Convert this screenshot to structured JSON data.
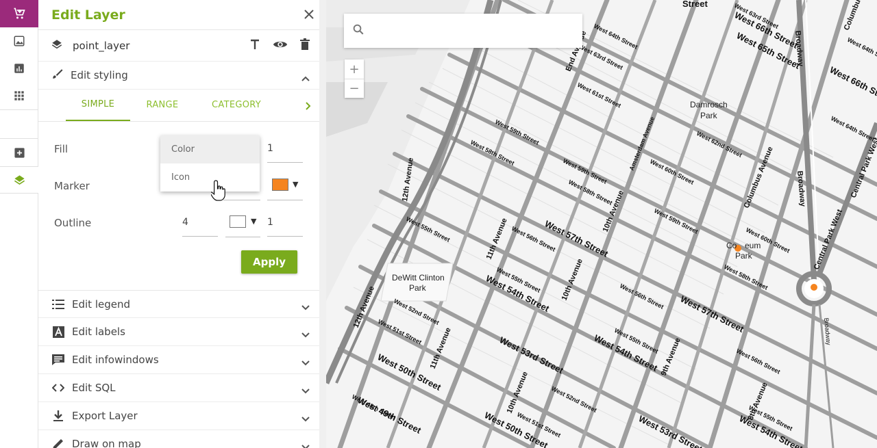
{
  "panel": {
    "title": "Edit Layer",
    "layer_name": "point_layer",
    "sections_open": {
      "edit_styling": "Edit styling"
    },
    "tabs": [
      "SIMPLE",
      "RANGE",
      "CATEGORY"
    ],
    "fields": {
      "fill_label": "Fill",
      "fill_opacity": "1",
      "marker_label": "Marker",
      "marker_color": "#f5841f",
      "outline_label": "Outline",
      "outline_width": "4",
      "outline_color": "#ffffff",
      "outline_opacity": "1"
    },
    "dropdown_options": [
      "Color",
      "Icon"
    ],
    "apply_label": "Apply",
    "sections": [
      {
        "label": "Edit legend",
        "icon": "list-icon"
      },
      {
        "label": "Edit labels",
        "icon": "label-icon"
      },
      {
        "label": "Edit infowindows",
        "icon": "infowindow-icon"
      },
      {
        "label": "Edit SQL",
        "icon": "code-icon"
      },
      {
        "label": "Export Layer",
        "icon": "download-icon"
      },
      {
        "label": "Draw on map",
        "icon": "pencil-icon"
      }
    ]
  },
  "colors": {
    "accent": "#7aab1d",
    "rail_active": "#9b2a7b",
    "marker": "#f5841f"
  },
  "map": {
    "search_placeholder": "",
    "zoom_in": "+",
    "zoom_out": "−",
    "labels": {
      "w64": "West 64th Street",
      "w63": "West 63rd Street",
      "w61": "West 61st Street",
      "w59a": "West 59th Street",
      "w58a": "West 58th Street",
      "w59b": "West 59th Street",
      "w58b": "West 58th Street",
      "w62": "West 62nd Street",
      "w60a": "West 60th Street",
      "w59c": "West 59th Street",
      "w60b": "West 60th Street",
      "w58c": "West 58th Street",
      "w55a": "West 55th Street",
      "w56a": "West 56th Street",
      "w57a": "West 57th Street",
      "w55b": "West 55th Street",
      "w54a": "West 54th Street",
      "w56b": "West 56th Street",
      "w57b": "West 57th Street",
      "w52a": "West 52nd Street",
      "w51a": "West 51st Street",
      "w50a": "West 50th Street",
      "w53a": "West 53rd Street",
      "w55c": "West 55th Street",
      "w54b": "West 54th Street",
      "w56c": "West 56th Street",
      "w49": "West 49th Street",
      "w48": "West 48th Street",
      "w52b": "West 52nd Street",
      "w51b": "West 51st Street",
      "w50b": "West 50th Street",
      "w53b": "West 53rd Street",
      "w55d": "West 55th Street",
      "w54c": "West 54th Street",
      "w66a": "West 66th Street",
      "w65": "West 65th Street",
      "w66b": "West 66th Street",
      "w64b": "West 64th Street",
      "w63b": "West 63rd Street",
      "w60c": "West 60th Street",
      "w58d": "West 58th Street",
      "av12a": "12th Avenue",
      "av12b": "12th Avenue",
      "av11a": "11th Avenue",
      "av11b": "11th Avenue",
      "av10a": "10th Avenue",
      "av10b": "10th Avenue",
      "av10c": "10th Avenue",
      "av9": "9th Avenue",
      "av8": "8th Avenue",
      "amst": "Amsterdam Avenue",
      "colav": "Columbus Avenue",
      "bway": "Broadway",
      "bway2": "Broadway",
      "cpw": "Central Park West",
      "cpw2": "Central Park West",
      "end": "End Avenue",
      "dam1": "Damrosch",
      "dam2": "Park",
      "dew1": "DeWitt Clinton",
      "dew2": "Park",
      "col1": "Co",
      "col2": "eum",
      "col3": "Park",
      "top1": "Street",
      "colum": "Columbu"
    }
  }
}
